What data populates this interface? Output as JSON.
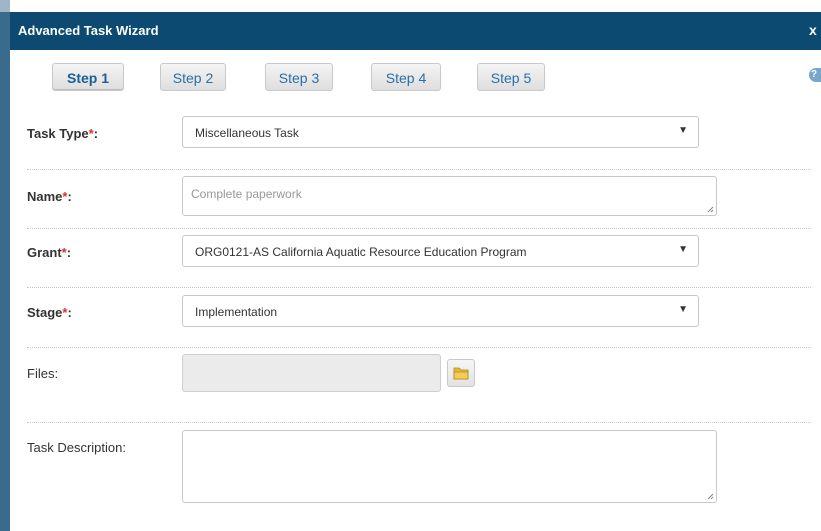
{
  "dialog": {
    "title": "Advanced Task Wizard",
    "close_label": "x"
  },
  "steps": [
    {
      "label": "Step 1",
      "active": true
    },
    {
      "label": "Step 2",
      "active": false
    },
    {
      "label": "Step 3",
      "active": false
    },
    {
      "label": "Step 4",
      "active": false
    },
    {
      "label": "Step 5",
      "active": false
    }
  ],
  "help_icon": {
    "name": "help-icon",
    "glyph": "?"
  },
  "form": {
    "task_type": {
      "label": "Task Type",
      "required_mark": "*",
      "suffix": ":",
      "value": "Miscellaneous Task"
    },
    "name": {
      "label": "Name",
      "required_mark": "*",
      "suffix": ":",
      "placeholder": "Complete paperwork"
    },
    "grant": {
      "label": "Grant",
      "required_mark": "*",
      "suffix": ":",
      "value": "ORG0121-AS California Aquatic Resource Education Program"
    },
    "stage": {
      "label": "Stage",
      "required_mark": "*",
      "suffix": ":",
      "value": "Implementation"
    },
    "files": {
      "label": "Files:",
      "browse_icon": "folder-icon"
    },
    "task_description": {
      "label": "Task Description:",
      "value": ""
    }
  },
  "colors": {
    "titlebar": "#0d4a72",
    "step_text": "#2a6fa8",
    "required": "#d9302c",
    "folder": "#e8b83a"
  }
}
